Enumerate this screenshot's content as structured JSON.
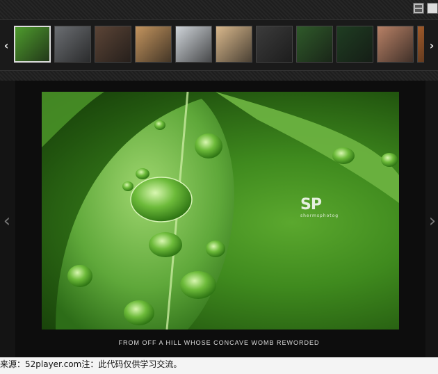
{
  "view_toggles": {
    "grid_icon": "grid-view-icon",
    "single_icon": "single-view-icon"
  },
  "thumbnails": {
    "left_arrow": "‹",
    "right_arrow": "›",
    "items": [
      {
        "name": "leaf-water-drops",
        "color": "#4e9b2d"
      },
      {
        "name": "street-scene",
        "color": "#6b6e72"
      },
      {
        "name": "two-boys",
        "color": "#5b4436"
      },
      {
        "name": "field-sky",
        "color": "#c3945e"
      },
      {
        "name": "hallway",
        "color": "#cfd4d9"
      },
      {
        "name": "beans",
        "color": "#d9b88c"
      },
      {
        "name": "camera-lens",
        "color": "#3b3b3b"
      },
      {
        "name": "lily-pads",
        "color": "#2f5a2a"
      },
      {
        "name": "dark-leaves",
        "color": "#1f3d22"
      },
      {
        "name": "smiling-child",
        "color": "#b88166"
      },
      {
        "name": "partial-photo",
        "color": "#a05a2a"
      }
    ]
  },
  "viewer": {
    "prev_arrow": "‹",
    "next_arrow": "›",
    "watermark_logo": "SP",
    "watermark_sub": "shermsphotog",
    "caption": "FROM OFF A HILL WHOSE CONCAVE WOMB REWORDED"
  },
  "footer": {
    "text": "来源：52player.com注：此代码仅供学习交流。"
  }
}
